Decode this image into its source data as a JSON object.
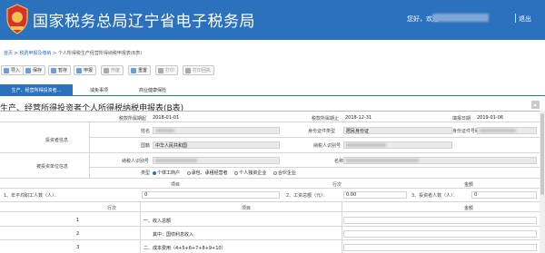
{
  "header": {
    "title": "国家税务总局辽宁省电子税务局",
    "welcome": "您好，欢迎",
    "logout": "退出",
    "emblem_icon": "tax-emblem-icon",
    "bg_color": "#2b71bd"
  },
  "breadcrumb": {
    "home": "首页",
    "sep": ">",
    "level2": "税费申报及缴纳",
    "level3": "个人所得税生产经营所得纳税申报表(B表)"
  },
  "toolbar": {
    "buttons": [
      {
        "label": "导入",
        "icon": "import-icon"
      },
      {
        "label": "保存",
        "icon": "save-icon"
      },
      {
        "label": "暂存",
        "icon": "temp-save-icon"
      },
      {
        "label": "申报",
        "icon": "declare-icon"
      },
      {
        "label": "作废",
        "icon": "void-icon"
      },
      {
        "label": "重置",
        "icon": "reset-icon"
      },
      {
        "label": "打印",
        "icon": "print-icon"
      },
      {
        "label": "打印回执",
        "icon": "print-receipt-icon"
      }
    ]
  },
  "tabs": [
    {
      "label": "生产、经营所得投资者...",
      "active": true
    },
    {
      "label": "减免事项",
      "active": false
    },
    {
      "label": "商业健康保险",
      "active": false
    }
  ],
  "form": {
    "title": "生产、经营所得投资者个人所得税纳税申报表(B表)",
    "period_start_label": "税款所属期起",
    "period_start": "2018-01-01",
    "period_end_label": "税款所属期止",
    "period_end": "2018-12-31",
    "fill_date_label": "填报日期",
    "fill_date": "2019-01-06",
    "investor_info_label": "投资者信息",
    "name_label": "姓名",
    "id_type_label": "身份证件类型",
    "id_type": "居民身份证",
    "id_no_label": "身份证件号码",
    "nationality_label": "国籍",
    "nationality": "中华人民共和国",
    "taxpayer_id_label": "纳税人识别号",
    "invested_unit_label": "被投资单位信息",
    "unit_taxpayer_id_label": "纳税人识别号",
    "unit_name_label": "名称",
    "type_label": "类型",
    "types": [
      "个体工商户",
      "承包、承租经营者",
      "个人独资企业",
      "合伙企业"
    ],
    "type_selected": 0,
    "col_item": "项目",
    "col_row": "行次",
    "col_amount": "金额",
    "q1_label": "1、年平均职工人数（人）：",
    "q1_value": "0",
    "q2_label": "2、工资总额（元）：",
    "q2_value": "0.00",
    "q3_label": "3、投资者人数（人）：",
    "q3_value": "0",
    "grid_head": {
      "row": "行次",
      "item": "项目",
      "amount": "金额"
    },
    "rows": [
      {
        "no": "1",
        "item": "一、收入总额"
      },
      {
        "no": "2",
        "item": "其中：国债利息收入"
      },
      {
        "no": "3",
        "item": "二、成本费用（4+5+6+7+8+9+10）"
      }
    ]
  }
}
